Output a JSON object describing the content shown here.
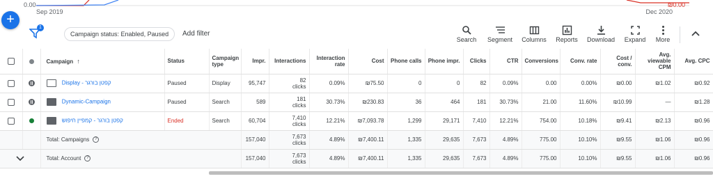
{
  "chart": {
    "left_axis_top": "0.00",
    "right_axis_top": "₪0.00",
    "date_start": "Sep 2019",
    "date_end": "Dec 2020"
  },
  "toolbar": {
    "filter_badge": "1",
    "status_chip": "Campaign status: Enabled, Paused",
    "add_filter": "Add filter",
    "search": "Search",
    "segment": "Segment",
    "columns": "Columns",
    "reports": "Reports",
    "download": "Download",
    "expand": "Expand",
    "more": "More"
  },
  "table": {
    "headers": {
      "campaign": "Campaign",
      "sort_arrow": "↑",
      "status": "Status",
      "campaign_type": "Campaign type",
      "impr": "Impr.",
      "interactions": "Interactions",
      "interaction_rate": "Interaction rate",
      "cost": "Cost",
      "phone_calls": "Phone calls",
      "phone_impr": "Phone impr.",
      "clicks": "Clicks",
      "ctr": "CTR",
      "conversions": "Conversions",
      "conv_rate": "Conv. rate",
      "cost_conv": "Cost / conv.",
      "avg_vcpm": "Avg. viewable CPM",
      "avg_cpc": "Avg. CPC"
    },
    "rows": [
      {
        "name": "Display - קפטן בורגר",
        "status": "Paused",
        "type": "Display",
        "impr": "95,747",
        "interactions": "82",
        "interactions_unit": "clicks",
        "interaction_rate": "0.09%",
        "cost": "₪75.50",
        "phone_calls": "0",
        "phone_impr": "0",
        "clicks": "82",
        "ctr": "0.09%",
        "conversions": "0.00",
        "conv_rate": "0.00%",
        "cost_conv": "₪0.00",
        "avg_vcpm": "₪1.02",
        "avg_cpc": "₪0.92"
      },
      {
        "name": "Dynamic-Campaign",
        "status": "Paused",
        "type": "Search",
        "impr": "589",
        "interactions": "181",
        "interactions_unit": "clicks",
        "interaction_rate": "30.73%",
        "cost": "₪230.83",
        "phone_calls": "36",
        "phone_impr": "464",
        "clicks": "181",
        "ctr": "30.73%",
        "conversions": "21.00",
        "conv_rate": "11.60%",
        "cost_conv": "₪10.99",
        "avg_vcpm": "—",
        "avg_cpc": "₪1.28"
      },
      {
        "name": "קפטן בורגר - קמפיין חיפוש",
        "status": "Ended",
        "type": "Search",
        "impr": "60,704",
        "interactions": "7,410",
        "interactions_unit": "clicks",
        "interaction_rate": "12.21%",
        "cost": "₪7,093.78",
        "phone_calls": "1,299",
        "phone_impr": "29,171",
        "clicks": "7,410",
        "ctr": "12.21%",
        "conversions": "754.00",
        "conv_rate": "10.18%",
        "cost_conv": "₪9.41",
        "avg_vcpm": "₪2.13",
        "avg_cpc": "₪0.96"
      }
    ],
    "totals": [
      {
        "label": "Total: Campaigns",
        "impr": "157,040",
        "interactions": "7,673",
        "interactions_unit": "clicks",
        "interaction_rate": "4.89%",
        "cost": "₪7,400.11",
        "phone_calls": "1,335",
        "phone_impr": "29,635",
        "clicks": "7,673",
        "ctr": "4.89%",
        "conversions": "775.00",
        "conv_rate": "10.10%",
        "cost_conv": "₪9.55",
        "avg_vcpm": "₪1.06",
        "avg_cpc": "₪0.96"
      },
      {
        "label": "Total: Account",
        "impr": "157,040",
        "interactions": "7,673",
        "interactions_unit": "clicks",
        "interaction_rate": "4.89%",
        "cost": "₪7,400.11",
        "phone_calls": "1,335",
        "phone_impr": "29,635",
        "clicks": "7,673",
        "ctr": "4.89%",
        "conversions": "775.00",
        "conv_rate": "10.10%",
        "cost_conv": "₪9.55",
        "avg_vcpm": "₪1.06",
        "avg_cpc": "₪0.96"
      }
    ]
  },
  "colors": {
    "accent": "#1a73e8",
    "ended": "#d93025",
    "enabled": "#188038",
    "line_blue": "#4285f4",
    "line_red": "#d93025"
  }
}
